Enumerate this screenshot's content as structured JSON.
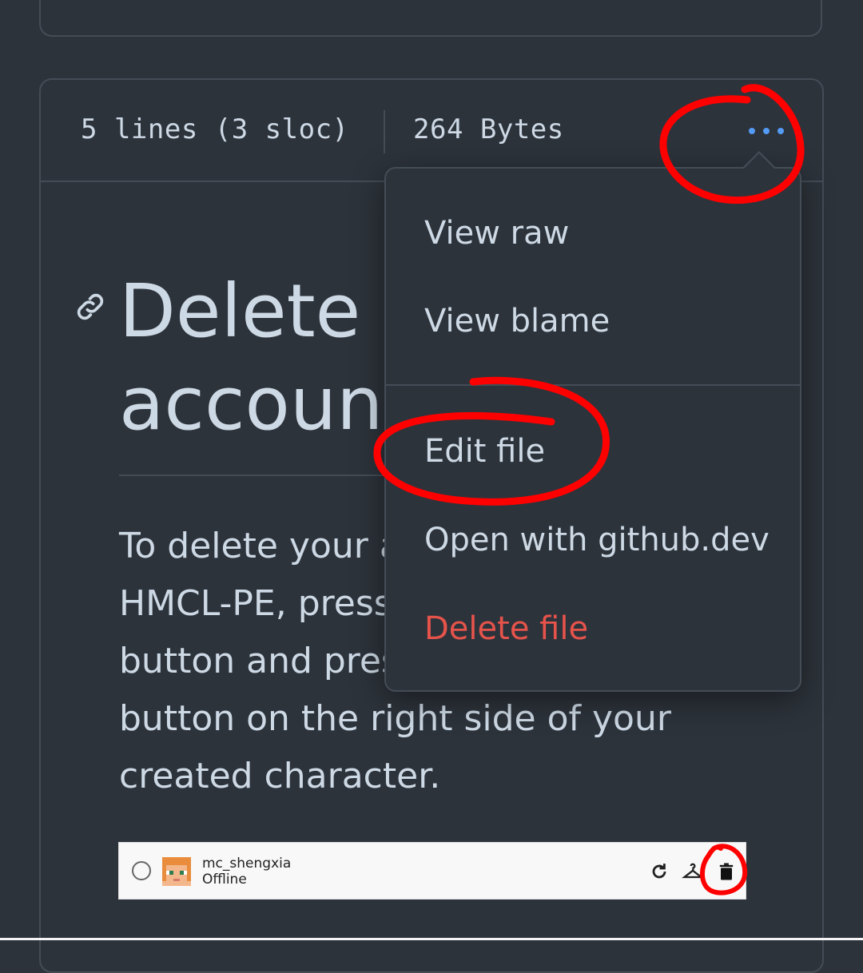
{
  "file_header": {
    "lines_info": "5 lines (3 sloc)",
    "size_info": "264 Bytes",
    "menu_icon": "kebab-horizontal-icon"
  },
  "content": {
    "heading": "Delete account",
    "body": "To delete your account, open HMCL-PE, press the \"Accounts\" button and press the \"Trashcan\" button on the right side of your created character."
  },
  "account_row": {
    "name": "mc_shengxia",
    "status": "Offline"
  },
  "dropdown_menu": {
    "items": [
      {
        "label": "View raw"
      },
      {
        "label": "View blame"
      },
      {
        "label": "Edit file"
      },
      {
        "label": "Open with github.dev"
      },
      {
        "label": "Delete file"
      }
    ]
  },
  "colors": {
    "background": "#2d333b",
    "border": "#444c56",
    "text": "#cdd9e5",
    "accent": "#539bf5",
    "danger": "#e5534b",
    "annotation": "#ff0000"
  }
}
